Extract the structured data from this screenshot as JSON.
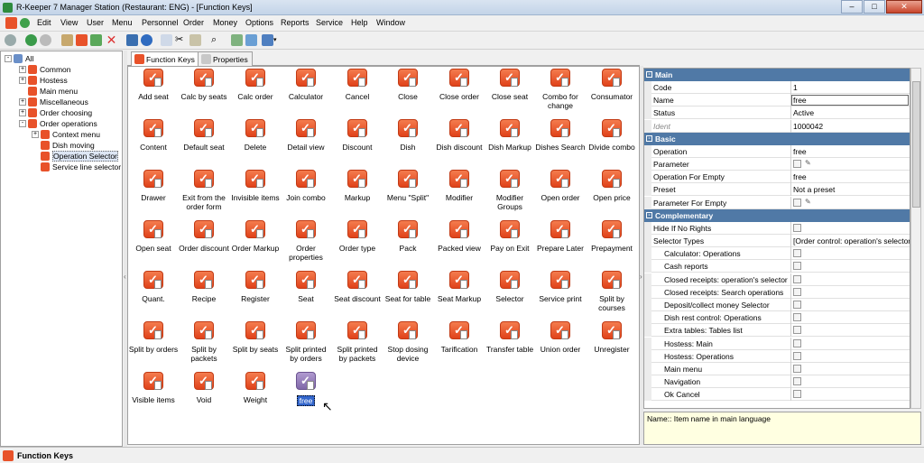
{
  "window": {
    "title": "R-Keeper 7 Manager Station (Restaurant: ENG) - [Function Keys]"
  },
  "menu": [
    "Edit",
    "View",
    "User",
    "Menu",
    "Personnel",
    "Order",
    "Money",
    "Options",
    "Reports",
    "Service",
    "Help",
    "Window"
  ],
  "tree": {
    "root": "All",
    "items": [
      {
        "label": "Common",
        "level": 1,
        "expand": "+"
      },
      {
        "label": "Hostess",
        "level": 1,
        "expand": "+"
      },
      {
        "label": "Main menu",
        "level": 1,
        "expand": ""
      },
      {
        "label": "Miscellaneous",
        "level": 1,
        "expand": "+"
      },
      {
        "label": "Order choosing",
        "level": 1,
        "expand": "+"
      },
      {
        "label": "Order operations",
        "level": 1,
        "expand": "-"
      },
      {
        "label": "Context menu",
        "level": 2,
        "expand": "+"
      },
      {
        "label": "Dish moving",
        "level": 2,
        "expand": ""
      },
      {
        "label": "Operation Selector",
        "level": 2,
        "expand": "",
        "selected": true
      },
      {
        "label": "Service line selector",
        "level": 2,
        "expand": ""
      }
    ]
  },
  "tabs": {
    "function_keys": "Function Keys",
    "properties": "Properties"
  },
  "function_keys": [
    [
      "Add seat",
      "Calc by seats",
      "Calc order",
      "Calculator",
      "Cancel",
      "Close",
      "Close order",
      "Close seat",
      "Combo for change",
      "Consumator"
    ],
    [
      "Content",
      "Default seat",
      "Delete",
      "Detail view",
      "Discount",
      "Dish",
      "Dish discount",
      "Dish Markup",
      "Dishes Search",
      "Divide combo"
    ],
    [
      "Drawer",
      "Exit from the order form",
      "Invisible items",
      "Join combo",
      "Markup",
      "Menu \"Split\"",
      "Modifier",
      "Modifier Groups",
      "Open order",
      "Open price"
    ],
    [
      "Open seat",
      "Order discount",
      "Order Markup",
      "Order properties",
      "Order type",
      "Pack",
      "Packed view",
      "Pay on Exit",
      "Prepare Later",
      "Prepayment"
    ],
    [
      "Quant.",
      "Recipe",
      "Register",
      "Seat",
      "Seat discount",
      "Seat for table",
      "Seat Markup",
      "Selector",
      "Service print",
      "Split by courses"
    ],
    [
      "Split by orders",
      "Split by packets",
      "Split by seats",
      "Split printed by orders",
      "Split printed by packets",
      "Stop dosing device",
      "Tarification",
      "Transfer table",
      "Union order",
      "Unregister"
    ],
    [
      "Visible items",
      "Void",
      "Weight",
      "free"
    ]
  ],
  "properties": {
    "main_group": "Main",
    "main": [
      {
        "k": "Code",
        "v": "1"
      },
      {
        "k": "Name",
        "v": "free"
      },
      {
        "k": "Status",
        "v": "Active"
      },
      {
        "k": "Ident",
        "v": "1000042"
      }
    ],
    "basic_group": "Basic",
    "basic": [
      {
        "k": "Operation",
        "v": "free"
      },
      {
        "k": "Parameter",
        "v": ""
      },
      {
        "k": "Operation For Empty",
        "v": "free"
      },
      {
        "k": "Preset",
        "v": "Not a preset"
      },
      {
        "k": "Parameter For Empty",
        "v": ""
      }
    ],
    "complementary_group": "Complementary",
    "complementary": [
      {
        "k": "Hide If No Rights",
        "v": ""
      },
      {
        "k": "Selector Types",
        "v": "[Order control: operation's selector, I"
      },
      {
        "k": "Calculator: Operations",
        "v": ""
      },
      {
        "k": "Cash reports",
        "v": ""
      },
      {
        "k": "Closed receipts: operation's selector",
        "v": ""
      },
      {
        "k": "Closed receipts: Search operations",
        "v": ""
      },
      {
        "k": "Deposit/collect money Selector",
        "v": ""
      },
      {
        "k": "Dish rest control: Operations",
        "v": ""
      },
      {
        "k": "Extra tables: Tables list",
        "v": ""
      },
      {
        "k": "Hostess: Main",
        "v": ""
      },
      {
        "k": "Hostess: Operations",
        "v": ""
      },
      {
        "k": "Main menu",
        "v": ""
      },
      {
        "k": "Navigation",
        "v": ""
      },
      {
        "k": "Ok Cancel",
        "v": ""
      }
    ]
  },
  "hint": "Name:: Item name in main language",
  "status": "Function Keys"
}
